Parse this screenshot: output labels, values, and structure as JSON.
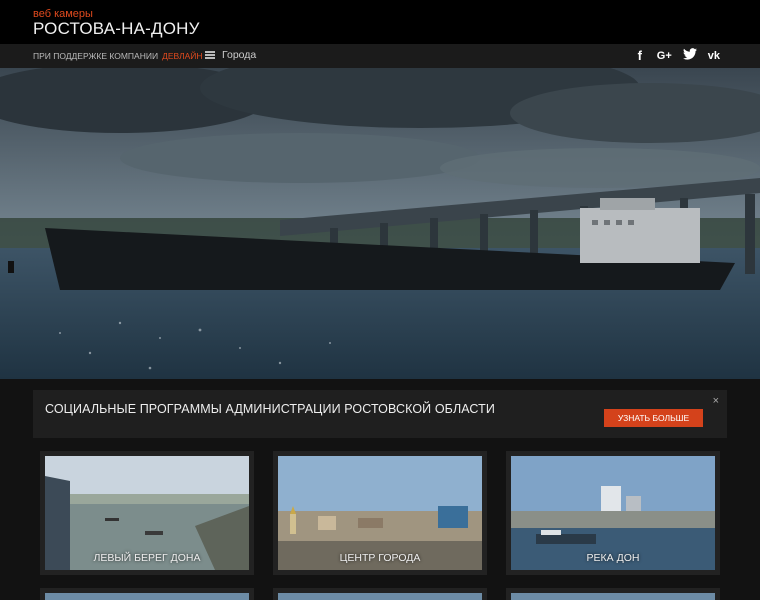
{
  "header": {
    "brand_small": "веб камеры",
    "brand_big": "РОСТОВА-НА-ДОНУ"
  },
  "subbar": {
    "support_text": "ПРИ ПОДДЕРЖКЕ КОМПАНИИ",
    "company": "ДЕВЛАЙН",
    "cities_label": "Города",
    "social": [
      "f",
      "G+",
      "twitter",
      "vk"
    ],
    "social_icons": [
      "facebook-icon",
      "google-plus-icon",
      "twitter-icon",
      "vk-icon"
    ]
  },
  "promo": {
    "text": "СОЦИАЛЬНЫЕ ПРОГРАММЫ АДМИНИСТРАЦИИ РОСТОВСКОЙ ОБЛАСТИ",
    "button": "УЗНАТЬ БОЛЬШЕ",
    "close": "×"
  },
  "cameras": [
    {
      "label": "ЛЕВЫЙ БЕРЕГ ДОНА"
    },
    {
      "label": "ЦЕНТР ГОРОДА"
    },
    {
      "label": "РЕКА ДОН"
    }
  ],
  "colors": {
    "accent": "#d4421b",
    "header_bg": "#000000",
    "page_bg": "#121212"
  }
}
